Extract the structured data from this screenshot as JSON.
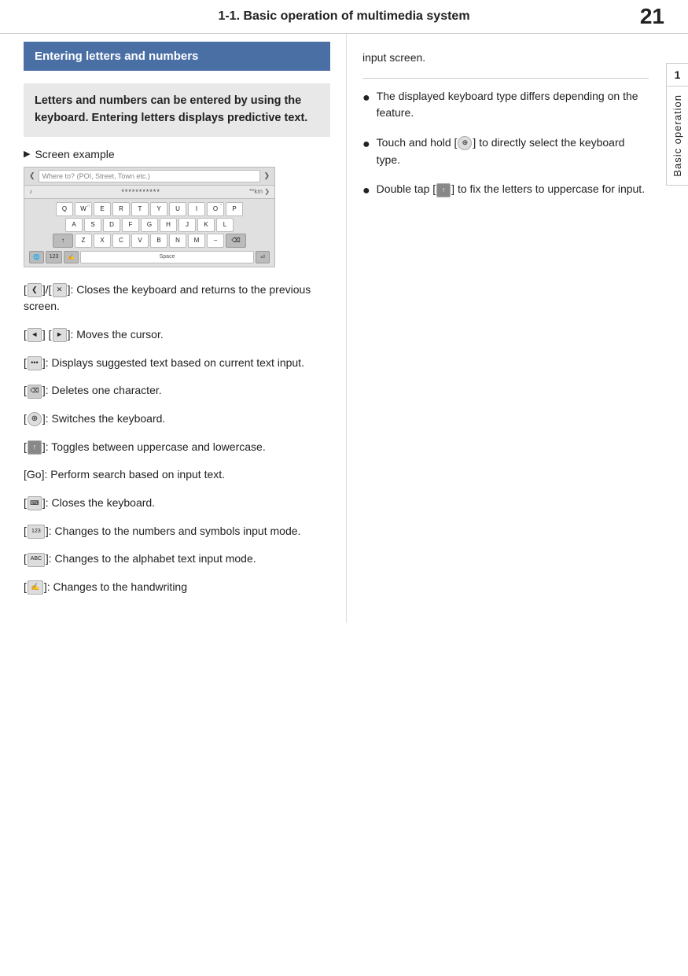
{
  "header": {
    "title": "1-1. Basic operation of multimedia system",
    "page_number": "21"
  },
  "side_tab": {
    "number": "1",
    "text": "Basic operation"
  },
  "section": {
    "title": "Entering letters and numbers",
    "intro": "Letters and numbers can be entered by using the keyboard. Entering letters displays predictive text.",
    "screen_example_label": "Screen example",
    "keyboard": {
      "search_placeholder": "Where to? (POI, Street, Town etc.)",
      "password_dots": "***********",
      "km_text": "**km",
      "row1": [
        "Q",
        "W",
        "E",
        "R",
        "T",
        "Y",
        "U",
        "I",
        "O",
        "P"
      ],
      "row1_subs": [
        "",
        "n",
        "",
        "",
        "",
        "",
        "",
        "",
        "",
        ""
      ],
      "row2": [
        "A",
        "S",
        "D",
        "F",
        "G",
        "H",
        "J",
        "K",
        "L"
      ],
      "row3_special": "shift",
      "row3": [
        "Z",
        "X",
        "C",
        "V",
        "B",
        "N",
        "M",
        "–"
      ],
      "bottom": [
        "globe",
        "123",
        "hand",
        "Space",
        "enter"
      ]
    },
    "body_items": [
      {
        "id": "close-keyboard",
        "icon_left": "❮",
        "icon_left2": "✕",
        "text": "]: Closes the keyboard and returns to the previous screen."
      },
      {
        "id": "cursor",
        "icon_left": "◄",
        "icon_left2": "►",
        "text": "]: Moves the cursor."
      },
      {
        "id": "suggested",
        "icon": "•••",
        "text": "]: Displays suggested text based on current text input."
      },
      {
        "id": "delete",
        "icon": "⌫",
        "text": "]: Deletes one character."
      },
      {
        "id": "switch-kb",
        "icon": "⊕",
        "text": "]: Switches the keyboard."
      },
      {
        "id": "uppercase",
        "icon": "↑",
        "text": "]: Toggles between uppercase and lowercase."
      },
      {
        "id": "go",
        "text": "[Go]: Perform search based on input text."
      },
      {
        "id": "close-kb2",
        "icon": "⌨",
        "text": "]: Closes the keyboard."
      },
      {
        "id": "numbers",
        "icon": "123",
        "text": "]: Changes to the numbers and symbols input mode."
      },
      {
        "id": "alphabet",
        "icon": "ABC",
        "text": "]: Changes to the alphabet text input mode."
      },
      {
        "id": "handwriting",
        "icon": "✍",
        "text": "]: Changes to the handwriting"
      }
    ]
  },
  "right_col": {
    "intro_text": "input screen.",
    "bullets": [
      {
        "id": "keyboard-type",
        "text": "The displayed keyboard type differs depending on the feature."
      },
      {
        "id": "touch-hold",
        "icon": "⊕",
        "text": "Touch and hold [  ] to directly select the keyboard type."
      },
      {
        "id": "double-tap",
        "icon": "↑",
        "text": "Double tap [  ] to fix the letters to uppercase for input."
      }
    ]
  }
}
